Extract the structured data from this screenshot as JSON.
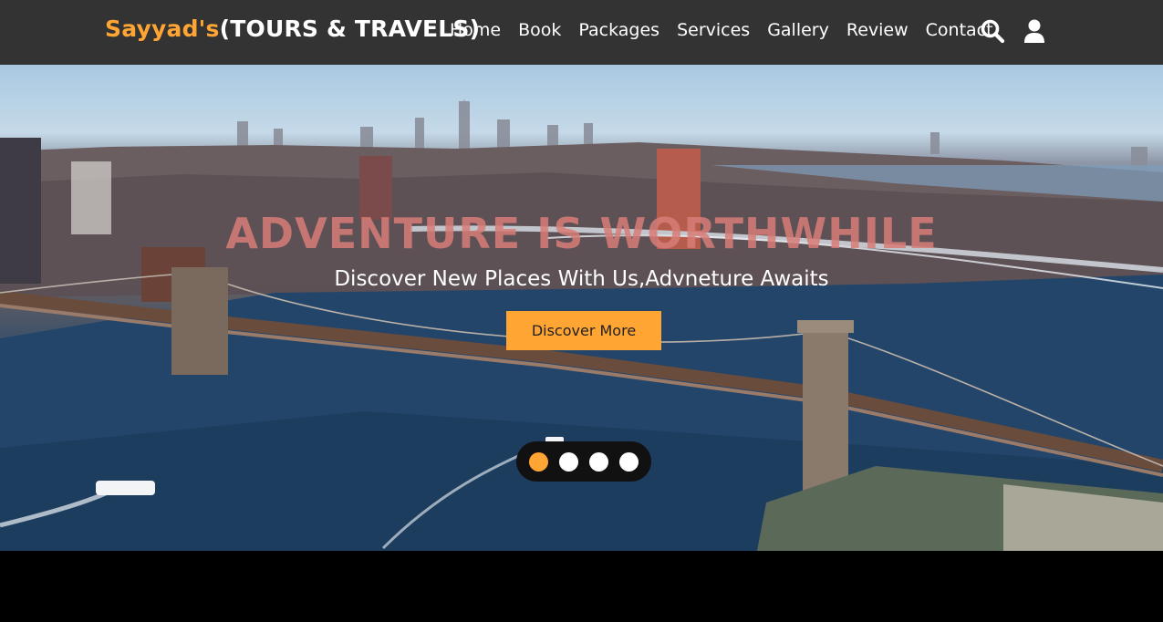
{
  "navbar": {
    "logo_brand": "Sayyad's",
    "logo_rest": "(TOURS & TRAVELS)",
    "links": [
      "Home",
      "Book",
      "Packages",
      "Services",
      "Gallery",
      "Review",
      "Contact"
    ],
    "icons": [
      "search-icon",
      "user-icon"
    ]
  },
  "hero": {
    "title": "ADVENTURE IS WORTHWHILE",
    "subtitle": "Discover New Places With Us,Advneture Awaits",
    "button_label": "Discover More",
    "slides_count": 4,
    "active_slide": 1
  },
  "colors": {
    "accent": "#ffa533",
    "navbar_bg": "#333333",
    "title": "#d97d78"
  }
}
